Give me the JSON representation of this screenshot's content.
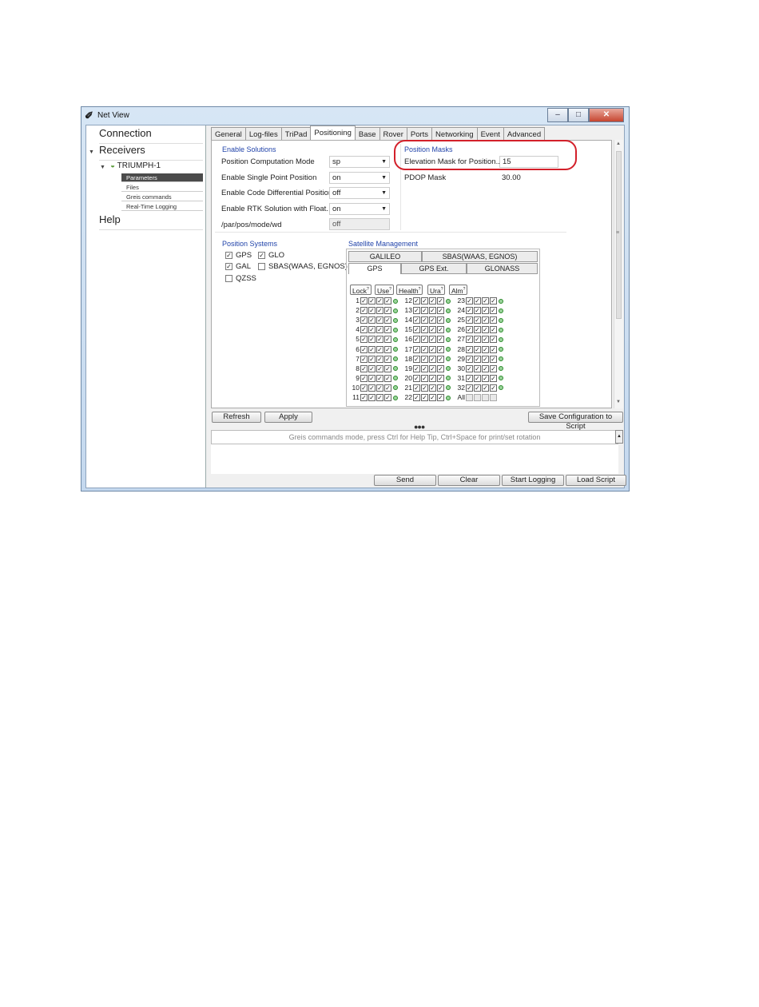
{
  "window": {
    "title": "Net View"
  },
  "sidebar": {
    "connection": "Connection",
    "receivers": "Receivers",
    "device": "TRIUMPH-1",
    "items": [
      "Parameters",
      "Files",
      "Greis commands",
      "Real-Time Logging"
    ],
    "help": "Help"
  },
  "tabs": [
    "General",
    "Log-files",
    "TriPad",
    "Positioning",
    "Base",
    "Rover",
    "Ports",
    "Networking",
    "Event",
    "Advanced"
  ],
  "enable_solutions": {
    "title": "Enable Solutions",
    "rows": [
      {
        "label": "Position Computation Mode",
        "value": "sp"
      },
      {
        "label": "Enable Single Point Position",
        "value": "on"
      },
      {
        "label": "Enable Code Differential Position",
        "value": "off"
      },
      {
        "label": "Enable RTK Solution with Float...",
        "value": "on"
      },
      {
        "label": "/par/pos/mode/wd",
        "value": "off"
      }
    ]
  },
  "position_masks": {
    "title": "Position Masks",
    "elevation_label": "Elevation Mask for Position...",
    "elevation_value": "15",
    "pdop_label": "PDOP Mask",
    "pdop_value": "30.00"
  },
  "position_systems": {
    "title": "Position Systems",
    "items": [
      {
        "label": "GPS",
        "checked": true
      },
      {
        "label": "GLO",
        "checked": true
      },
      {
        "label": "GAL",
        "checked": true
      },
      {
        "label": "SBAS(WAAS, EGNOS)",
        "checked": false
      },
      {
        "label": "QZSS",
        "checked": false
      }
    ]
  },
  "satellite_management": {
    "title": "Satellite Management",
    "tabs_row1": [
      "GALILEO",
      "SBAS(WAAS, EGNOS)"
    ],
    "tabs_row2": [
      "GPS",
      "GPS Ext.",
      "GLONASS"
    ],
    "columns": [
      "Lock",
      "Use",
      "Health",
      "Ura",
      "Alm"
    ],
    "all_label": "All"
  },
  "buttons": {
    "refresh": "Refresh",
    "apply": "Apply",
    "save_script": "Save Configuration to Script",
    "send": "Send",
    "clear": "Clear",
    "start_logging": "Start Logging",
    "load_script": "Load Script"
  },
  "command_hint": "Greis commands mode, press Ctrl for Help Tip, Ctrl+Space for print/set rotation",
  "icons": {
    "app": "app-logo-icon",
    "expand": "triangle-down-icon",
    "device": "receiver-icon",
    "dropdown": "chevron-down-icon"
  },
  "colors": {
    "highlight": "#d3202a",
    "group_title": "#2244aa",
    "status_dot": "#2c8a2c",
    "selected_item": "#4b4b4b"
  }
}
